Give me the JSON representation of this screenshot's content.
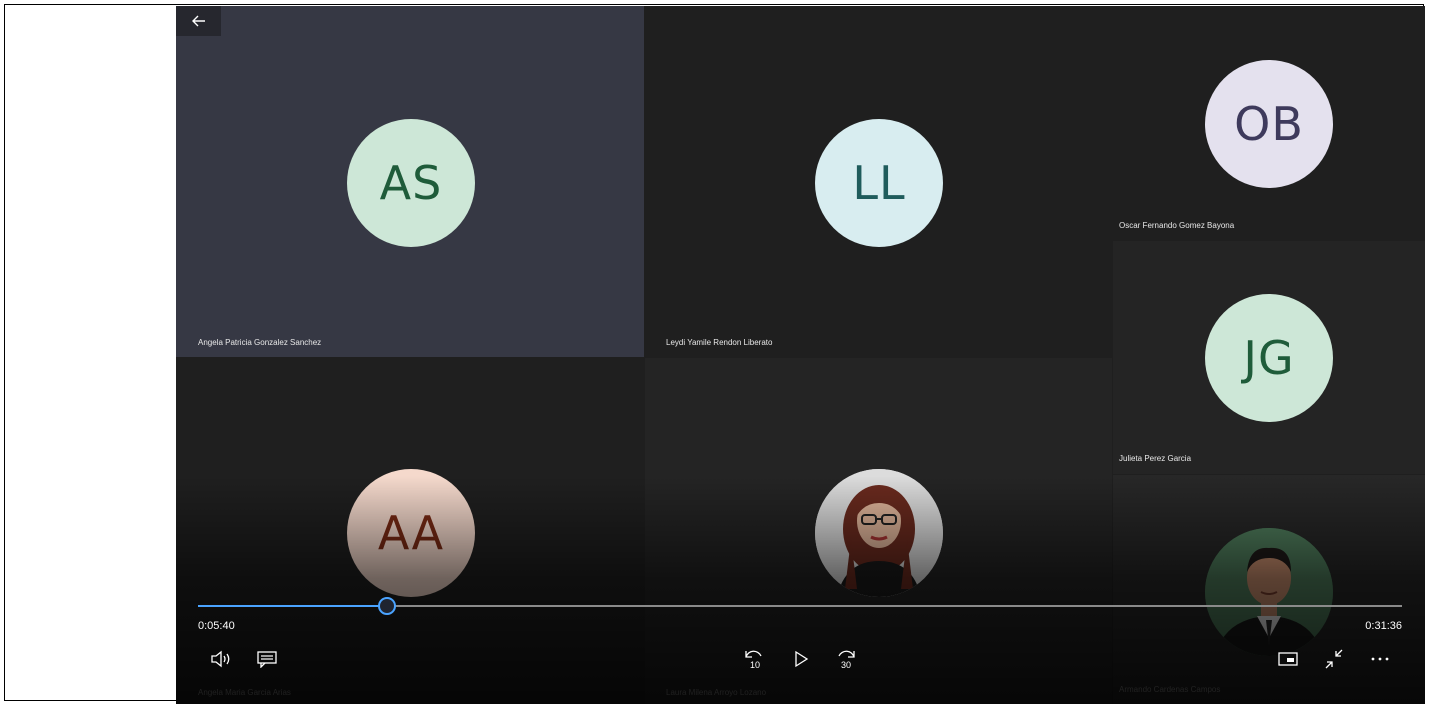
{
  "participants": [
    {
      "initials": "AS",
      "name": "Angela Patricia Gonzalez Sanchez",
      "avatar_bg": "#cde7d7",
      "avatar_fg": "#1f5c3a"
    },
    {
      "initials": "LL",
      "name": "Leydi Yamile Rendon Liberato",
      "avatar_bg": "#d8edf0",
      "avatar_fg": "#1f5c5c"
    },
    {
      "initials": "OB",
      "name": "Oscar Fernando Gomez Bayona",
      "avatar_bg": "#e4e1ee",
      "avatar_fg": "#3e3a5c"
    },
    {
      "initials": "AA",
      "name": "Angela Maria Garcia Arias",
      "avatar_bg": "#f5d9cc",
      "avatar_fg": "#7a2a14"
    },
    {
      "initials": "",
      "name": "Laura Milena Arroyo Lozano",
      "avatar": "photo-woman"
    },
    {
      "initials": "JG",
      "name": "Julieta Perez Garcia",
      "avatar_bg": "#cde7d7",
      "avatar_fg": "#1f5c3a"
    },
    {
      "initials": "",
      "name": "Armando Cardenas Campos",
      "avatar": "photo-man"
    }
  ],
  "player": {
    "current_time": "0:05:40",
    "total_time": "0:31:36",
    "progress_fraction": 0.157,
    "skip_back_label": "10",
    "skip_forward_label": "30",
    "accent_color": "#4aa3ff"
  }
}
